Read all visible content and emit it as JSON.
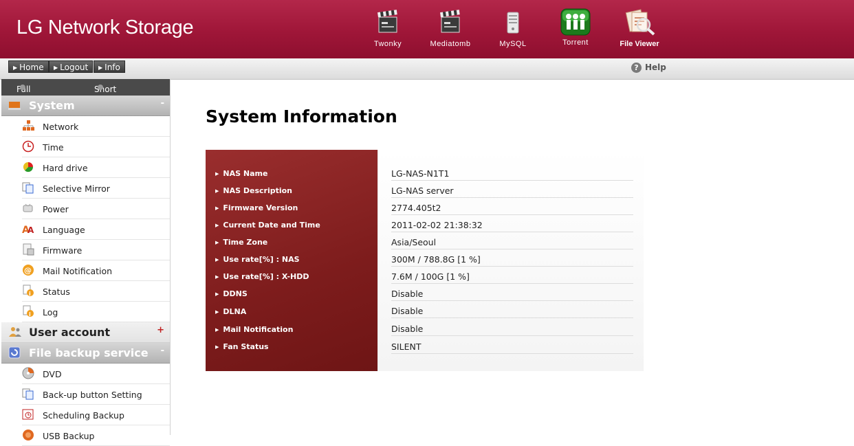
{
  "header": {
    "title": "LG Network Storage",
    "apps": [
      {
        "label": "Twonky",
        "icon": "clapperboard-icon"
      },
      {
        "label": "Mediatomb",
        "icon": "clapperboard-icon"
      },
      {
        "label": "MySQL",
        "icon": "server-icon"
      },
      {
        "label": "Torrent",
        "icon": "people-icon"
      },
      {
        "label": "File Viewer",
        "icon": "file-viewer-icon"
      }
    ]
  },
  "toolbar": {
    "home": "Home",
    "logout": "Logout",
    "info": "Info",
    "help": "Help",
    "help_icon": "?"
  },
  "sidebar": {
    "full_menu": "Full Menu",
    "short_menu": "Short Menu",
    "system": {
      "title": "System",
      "toggle": "-",
      "items": [
        {
          "label": "Network",
          "icon": "network-icon"
        },
        {
          "label": "Time",
          "icon": "clock-icon"
        },
        {
          "label": "Hard drive",
          "icon": "hard-drive-icon"
        },
        {
          "label": "Selective Mirror",
          "icon": "mirror-icon"
        },
        {
          "label": "Power",
          "icon": "power-icon"
        },
        {
          "label": "Language",
          "icon": "language-icon"
        },
        {
          "label": "Firmware",
          "icon": "firmware-icon"
        },
        {
          "label": "Mail Notification",
          "icon": "mail-icon"
        },
        {
          "label": "Status",
          "icon": "status-icon"
        },
        {
          "label": "Log",
          "icon": "log-icon"
        }
      ]
    },
    "user_account": {
      "title": "User account",
      "toggle": "+"
    },
    "file_backup": {
      "title": "File backup service",
      "toggle": "-",
      "items": [
        {
          "label": "DVD",
          "icon": "dvd-icon"
        },
        {
          "label": "Back-up button Setting",
          "icon": "backup-button-icon"
        },
        {
          "label": "Scheduling Backup",
          "icon": "schedule-icon"
        },
        {
          "label": "USB Backup",
          "icon": "usb-icon"
        }
      ]
    }
  },
  "main": {
    "title": "System Information",
    "rows": [
      {
        "label": "NAS Name",
        "value": "LG-NAS-N1T1"
      },
      {
        "label": "NAS Description",
        "value": "LG-NAS server"
      },
      {
        "label": "Firmware Version",
        "value": "2774.405t2"
      },
      {
        "label": "Current Date and Time",
        "value": "2011-02-02 21:38:32"
      },
      {
        "label": "Time Zone",
        "value": "Asia/Seoul"
      },
      {
        "label": "Use rate[%] : NAS",
        "value": "300M / 788.8G [1 %]"
      },
      {
        "label": "Use rate[%] : X-HDD",
        "value": "7.6M / 100G [1 %]"
      },
      {
        "label": "DDNS",
        "value": "Disable"
      },
      {
        "label": "DLNA",
        "value": "Disable"
      },
      {
        "label": "Mail Notification",
        "value": "Disable"
      },
      {
        "label": "Fan Status",
        "value": "SILENT"
      }
    ]
  },
  "colors": {
    "header": "#9f1638",
    "info_panel": "#7d1c1c",
    "sidebar_section": "#b3b3b3"
  }
}
